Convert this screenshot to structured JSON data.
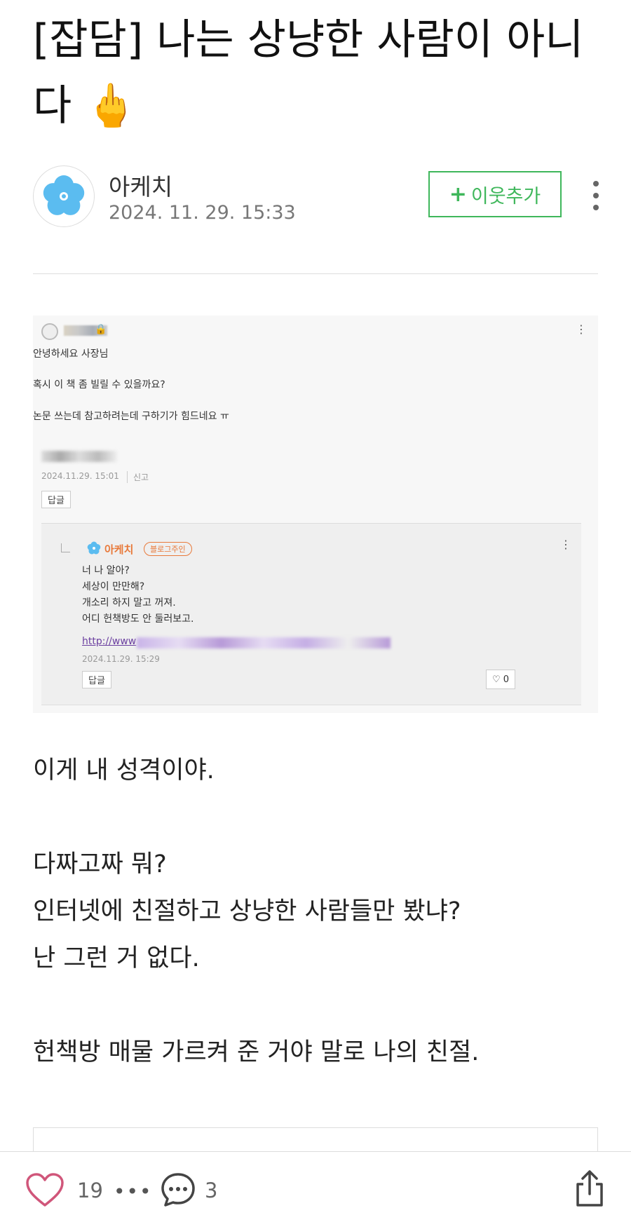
{
  "post": {
    "title": "[잡담] 나는 상냥한 사람이 아니다 🖕",
    "author": "아케치",
    "date": "2024. 11. 29. 15:33",
    "follow_label": "이웃추가"
  },
  "screenshot": {
    "comment_lines": [
      "안녕하세요 사장님",
      "혹시 이 책 좀 빌릴 수 있을까요?",
      "논문 쓰는데 참고하려는데 구하기가 힘드네요 ㅠ"
    ],
    "comment_date": "2024.11.29. 15:01",
    "report_label": "신고",
    "reply_label": "답글",
    "reply": {
      "name": "아케치",
      "badge": "블로그주인",
      "lines": [
        "너 나 알아?",
        "세상이 만만해?",
        "개소리 하지 말고 꺼져.",
        "어디 헌책방도 안 둘러보고."
      ],
      "link_text": "http://www",
      "date": "2024.11.29. 15:29",
      "reply_label": "답글",
      "likes": "0"
    }
  },
  "body": {
    "p1": "이게 내 성격이야.",
    "p2": "다짜고짜 뭐?",
    "p3": "인터넷에 친절하고 상냥한 사람들만 봤냐?",
    "p4": "난 그런 거 없다.",
    "p5": "헌책방 매물 가르켜 준 거야 말로 나의 친절."
  },
  "footer": {
    "like_count": "19",
    "more": "•••",
    "comment_count": "3"
  },
  "colors": {
    "follow_green": "#3fb75b",
    "owner_orange": "#e8793a",
    "link_purple": "#6b3fa0",
    "heart_pink": "#d0567a"
  }
}
